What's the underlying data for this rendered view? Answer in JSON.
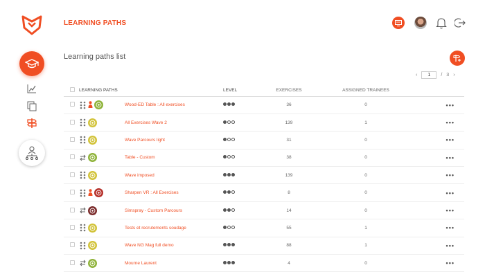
{
  "header": {
    "title": "LEARNING PATHS"
  },
  "page": {
    "title": "Learning paths list"
  },
  "pagination": {
    "current": "1",
    "separator": "/",
    "total": "3",
    "prev": "‹",
    "next": "›"
  },
  "table": {
    "columns": [
      "LEARNING PATHS",
      "LEVEL",
      "EXERCISES",
      "ASSIGNED TRAINEES"
    ],
    "more_label": "•••",
    "rows": [
      {
        "name": "Wood-ED Table : All exercises",
        "level": 3,
        "exercises": "36",
        "trainees": "0",
        "mode": "sorted-person",
        "badge": "wood"
      },
      {
        "name": "All Exercises Wave 2",
        "level": 1,
        "exercises": "139",
        "trainees": "1",
        "mode": "sorted",
        "badge": "wave"
      },
      {
        "name": "Wave Parcours light",
        "level": 1,
        "exercises": "31",
        "trainees": "0",
        "mode": "sorted",
        "badge": "wave"
      },
      {
        "name": "Table - Custom",
        "level": 1,
        "exercises": "38",
        "trainees": "0",
        "mode": "loop",
        "badge": "wood"
      },
      {
        "name": "Wave imposed",
        "level": 3,
        "exercises": "139",
        "trainees": "0",
        "mode": "sorted",
        "badge": "wave"
      },
      {
        "name": "Sharpen VR : All Exercises",
        "level": 2,
        "exercises": "8",
        "trainees": "0",
        "mode": "sorted-person",
        "badge": "sharpen"
      },
      {
        "name": "Simspray - Custom Parcours",
        "level": 2,
        "exercises": "14",
        "trainees": "0",
        "mode": "loop",
        "badge": "simspray"
      },
      {
        "name": "Tests et recrutements soudage",
        "level": 1,
        "exercises": "55",
        "trainees": "1",
        "mode": "sorted",
        "badge": "wave"
      },
      {
        "name": "Wave NG Mag full demo",
        "level": 3,
        "exercises": "88",
        "trainees": "1",
        "mode": "sorted",
        "badge": "wave"
      },
      {
        "name": "Mourne Laurent",
        "level": 3,
        "exercises": "4",
        "trainees": "0",
        "mode": "loop",
        "badge": "wood"
      }
    ]
  },
  "colors": {
    "accent": "#f04e23",
    "wood": "#8fb33a",
    "wave": "#d2c33a",
    "sharpen": "#b5302a",
    "simspray": "#7a2a2a"
  },
  "icons": {
    "logo": "fox-logo-icon",
    "nav_main": "graduation-cap-icon",
    "nav_stats": "chart-line-icon",
    "nav_copy": "copy-icon",
    "nav_paths": "signpost-icon",
    "nav_org": "organization-icon",
    "top_screen": "screen-icon",
    "top_bell": "bell-icon",
    "top_logout": "logout-icon",
    "fab": "add-path-icon"
  }
}
